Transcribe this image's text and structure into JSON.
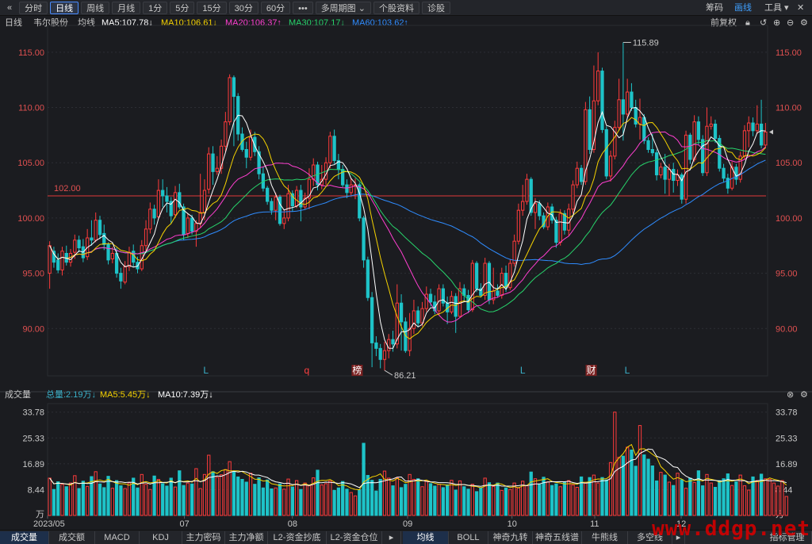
{
  "toolbar": {
    "back": "«",
    "items": [
      "分时",
      "日线",
      "周线",
      "月线",
      "1分",
      "5分",
      "15分",
      "30分",
      "60分",
      "•••",
      "多周期图 ⌄",
      "个股资料",
      "诊股"
    ],
    "active_index": 1,
    "right": [
      "筹码",
      "画线",
      "工具 ▾"
    ],
    "active_color": "#3fa0ff"
  },
  "legend": {
    "period": "日线",
    "stock": "韦尔股份",
    "avg": "均线",
    "ma5": "MA5:107.78↓",
    "ma10": "MA10:106.61↓",
    "ma20": "MA20:106.37↑",
    "ma30": "MA30:107.17↓",
    "ma60": "MA60:103.62↑",
    "adj": "前复权",
    "colors": {
      "ma5": "#ffffff",
      "ma10": "#f5d200",
      "ma20": "#ff3fd0",
      "ma30": "#27d36b",
      "ma60": "#2f8cff"
    }
  },
  "volume_legend": {
    "title": "成交量",
    "total": "总量:2.19万↓",
    "ma5": "MA5:5.45万↓",
    "ma10": "MA10:7.39万↓"
  },
  "chart_data": {
    "type": "candlestick",
    "price_axis": {
      "ticks": [
        "115.00",
        "110.00",
        "105.00",
        "100.00",
        "95.00",
        "90.00"
      ],
      "ylim": [
        86,
        117
      ]
    },
    "volume_axis": {
      "ticks": [
        "33.78",
        "25.33",
        "16.89",
        "8.44",
        "万"
      ],
      "ylim": [
        0,
        35
      ]
    },
    "x_labels": [
      "2023/05",
      "07",
      "08",
      "09",
      "10",
      "11",
      "12"
    ],
    "reference_line": {
      "value": 102.0,
      "label": "102.00"
    },
    "annotations": [
      {
        "text": "115.89"
      },
      {
        "text": "86.21"
      }
    ],
    "markers": [
      {
        "text": "L",
        "color": "#3ab0c8",
        "x": 0.22
      },
      {
        "text": "q",
        "color": "#ff4040",
        "x": 0.36
      },
      {
        "text": "榜",
        "color": "#ffffff",
        "bg": "#7a2020",
        "x": 0.43
      },
      {
        "text": "L",
        "color": "#3ab0c8",
        "x": 0.66
      },
      {
        "text": "财",
        "color": "#ffffff",
        "bg": "#7a2020",
        "x": 0.755
      },
      {
        "text": "L",
        "color": "#3ab0c8",
        "x": 0.805
      }
    ],
    "candles": [
      [
        95.0,
        97.5,
        93.6,
        97.9
      ],
      [
        97.0,
        96.0,
        95.5,
        97.4
      ],
      [
        96.2,
        95.3,
        95.0,
        96.8
      ],
      [
        95.3,
        97.0,
        94.8,
        97.4
      ],
      [
        96.8,
        96.0,
        95.7,
        97.5
      ],
      [
        96.0,
        96.8,
        95.6,
        97.2
      ],
      [
        96.9,
        98.0,
        96.3,
        98.5
      ],
      [
        98.0,
        97.3,
        96.9,
        98.4
      ],
      [
        97.4,
        96.4,
        96.0,
        98.1
      ],
      [
        96.5,
        98.2,
        96.2,
        99.0
      ],
      [
        98.2,
        98.0,
        97.5,
        99.8
      ],
      [
        98.0,
        99.8,
        97.8,
        100.5
      ],
      [
        99.8,
        98.5,
        98.1,
        100.2
      ],
      [
        98.6,
        97.6,
        97.1,
        99.4
      ],
      [
        97.6,
        96.2,
        95.8,
        97.8
      ],
      [
        96.3,
        96.8,
        95.9,
        97.4
      ],
      [
        96.8,
        95.0,
        94.6,
        97.3
      ],
      [
        95.0,
        94.3,
        93.6,
        95.5
      ],
      [
        94.2,
        95.6,
        94.0,
        96.1
      ],
      [
        95.6,
        96.9,
        95.2,
        97.4
      ],
      [
        97.0,
        96.0,
        95.6,
        97.6
      ],
      [
        96.0,
        95.4,
        95.0,
        96.5
      ],
      [
        95.4,
        97.5,
        95.2,
        98.0
      ],
      [
        97.5,
        99.0,
        97.0,
        99.8
      ],
      [
        99.0,
        100.8,
        98.6,
        101.4
      ],
      [
        100.8,
        100.0,
        99.4,
        101.2
      ],
      [
        100.1,
        102.5,
        99.9,
        103.5
      ],
      [
        102.5,
        102.0,
        101.0,
        103.5
      ],
      [
        102.0,
        101.5,
        100.5,
        102.8
      ],
      [
        101.5,
        100.2,
        99.5,
        101.9
      ],
      [
        100.3,
        102.3,
        100.0,
        102.9
      ],
      [
        102.3,
        101.0,
        100.8,
        103.1
      ],
      [
        101.0,
        98.5,
        98.0,
        101.3
      ],
      [
        98.6,
        100.0,
        98.2,
        100.4
      ],
      [
        100.0,
        98.8,
        98.5,
        100.3
      ],
      [
        98.8,
        99.5,
        97.4,
        99.8
      ],
      [
        99.5,
        100.5,
        99.1,
        104.0
      ],
      [
        100.5,
        102.5,
        99.8,
        103.5
      ],
      [
        102.6,
        105.8,
        102.2,
        106.4
      ],
      [
        105.8,
        104.2,
        103.0,
        106.5
      ],
      [
        104.2,
        104.5,
        103.9,
        105.6
      ],
      [
        104.5,
        106.5,
        104.0,
        107.1
      ],
      [
        106.5,
        108.7,
        106.0,
        109.6
      ],
      [
        108.7,
        112.7,
        108.4,
        113.0
      ],
      [
        112.7,
        111.0,
        106.5,
        112.9
      ],
      [
        111.0,
        107.6,
        107.0,
        111.3
      ],
      [
        107.6,
        106.2,
        106.0,
        108.2
      ],
      [
        106.2,
        105.5,
        104.5,
        106.9
      ],
      [
        105.5,
        107.3,
        105.2,
        108.0
      ],
      [
        107.3,
        106.0,
        105.6,
        107.8
      ],
      [
        106.0,
        104.0,
        103.5,
        106.5
      ],
      [
        104.0,
        102.7,
        102.4,
        104.6
      ],
      [
        102.7,
        101.5,
        101.2,
        102.9
      ],
      [
        101.5,
        100.7,
        100.3,
        101.8
      ],
      [
        100.7,
        101.9,
        99.8,
        102.3
      ],
      [
        101.9,
        99.5,
        99.3,
        102.1
      ],
      [
        99.5,
        100.0,
        99.0,
        100.8
      ],
      [
        100.0,
        102.2,
        99.7,
        103.0
      ],
      [
        102.2,
        101.1,
        100.6,
        102.5
      ],
      [
        101.1,
        102.5,
        100.9,
        102.9
      ],
      [
        102.5,
        101.0,
        99.7,
        103.0
      ],
      [
        101.0,
        101.8,
        100.8,
        102.3
      ],
      [
        101.8,
        103.5,
        100.8,
        104.5
      ],
      [
        103.5,
        104.8,
        102.9,
        105.4
      ],
      [
        104.8,
        103.0,
        102.5,
        105.1
      ],
      [
        103.0,
        103.5,
        102.6,
        104.8
      ],
      [
        103.5,
        105.0,
        103.0,
        105.5
      ],
      [
        105.0,
        107.4,
        104.5,
        107.8
      ],
      [
        107.4,
        105.2,
        104.9,
        108.0
      ],
      [
        105.2,
        104.4,
        103.5,
        105.8
      ],
      [
        104.4,
        103.0,
        102.8,
        104.8
      ],
      [
        103.0,
        102.3,
        101.8,
        103.5
      ],
      [
        102.3,
        103.0,
        101.9,
        103.6
      ],
      [
        103.0,
        103.0,
        101.7,
        103.6
      ],
      [
        103.0,
        100.0,
        99.7,
        103.2
      ],
      [
        100.0,
        96.2,
        95.5,
        100.2
      ],
      [
        96.2,
        92.8,
        92.5,
        96.5
      ],
      [
        92.8,
        88.7,
        86.5,
        93.3
      ],
      [
        88.7,
        88.2,
        87.5,
        89.3
      ],
      [
        88.2,
        87.2,
        86.4,
        88.6
      ],
      [
        87.2,
        88.0,
        86.21,
        88.8
      ],
      [
        88.0,
        89.0,
        87.3,
        89.5
      ],
      [
        89.0,
        88.6,
        87.9,
        89.8
      ],
      [
        88.6,
        92.3,
        88.2,
        94.0
      ],
      [
        92.3,
        90.6,
        88.0,
        93.1
      ],
      [
        90.6,
        88.0,
        87.8,
        91.0
      ],
      [
        88.0,
        90.0,
        87.5,
        91.4
      ],
      [
        90.0,
        91.6,
        89.5,
        92.6
      ],
      [
        91.6,
        90.5,
        90.2,
        92.0
      ],
      [
        90.5,
        91.8,
        90.2,
        92.4
      ],
      [
        91.8,
        93.1,
        91.5,
        93.8
      ],
      [
        93.1,
        92.4,
        92.0,
        93.6
      ],
      [
        92.4,
        91.6,
        91.3,
        93.0
      ],
      [
        91.6,
        93.6,
        91.2,
        94.0
      ],
      [
        93.6,
        92.3,
        92.0,
        94.0
      ],
      [
        92.3,
        91.5,
        90.4,
        92.9
      ],
      [
        91.5,
        92.9,
        91.3,
        93.4
      ],
      [
        92.9,
        91.1,
        89.6,
        93.2
      ],
      [
        91.1,
        93.6,
        91.0,
        94.2
      ],
      [
        93.6,
        93.0,
        92.5,
        94.0
      ],
      [
        93.0,
        91.7,
        91.4,
        93.5
      ],
      [
        91.7,
        95.9,
        91.5,
        96.2
      ],
      [
        95.9,
        93.6,
        93.3,
        96.1
      ],
      [
        93.6,
        93.0,
        92.8,
        94.1
      ],
      [
        93.0,
        95.9,
        92.6,
        96.4
      ],
      [
        95.9,
        92.6,
        92.2,
        96.1
      ],
      [
        92.6,
        93.4,
        92.2,
        95.5
      ],
      [
        93.4,
        93.0,
        92.8,
        94.0
      ],
      [
        93.0,
        95.0,
        92.7,
        95.5
      ],
      [
        95.0,
        93.7,
        93.3,
        95.7
      ],
      [
        93.7,
        95.9,
        93.5,
        96.3
      ],
      [
        95.9,
        97.9,
        95.6,
        98.5
      ],
      [
        97.9,
        100.7,
        97.6,
        101.3
      ],
      [
        100.7,
        101.5,
        100.2,
        103.0
      ],
      [
        101.5,
        103.5,
        101.2,
        104.0
      ],
      [
        103.5,
        100.5,
        100.2,
        103.7
      ],
      [
        100.5,
        101.3,
        99.0,
        101.8
      ],
      [
        101.3,
        100.2,
        99.8,
        101.6
      ],
      [
        100.2,
        99.2,
        99.0,
        100.5
      ],
      [
        99.2,
        101.0,
        98.9,
        101.4
      ],
      [
        101.0,
        99.8,
        99.5,
        101.3
      ],
      [
        99.8,
        97.8,
        97.3,
        100.1
      ],
      [
        97.8,
        100.4,
        97.5,
        100.8
      ],
      [
        100.4,
        98.9,
        98.5,
        100.7
      ],
      [
        98.9,
        100.8,
        98.4,
        101.3
      ],
      [
        100.8,
        103.0,
        100.4,
        103.4
      ],
      [
        103.0,
        104.5,
        102.7,
        105.1
      ],
      [
        104.5,
        103.3,
        103.0,
        104.8
      ],
      [
        103.3,
        109.8,
        103.0,
        110.5
      ],
      [
        109.8,
        106.2,
        105.8,
        111.0
      ],
      [
        106.2,
        110.6,
        105.9,
        113.8
      ],
      [
        110.6,
        113.3,
        110.2,
        115.0
      ],
      [
        113.3,
        108.0,
        107.7,
        113.6
      ],
      [
        108.0,
        103.8,
        103.5,
        108.3
      ],
      [
        103.8,
        105.6,
        103.3,
        106.1
      ],
      [
        105.6,
        108.2,
        105.3,
        108.8
      ],
      [
        108.2,
        110.7,
        107.9,
        112.6
      ],
      [
        110.7,
        109.4,
        107.0,
        115.89
      ],
      [
        109.4,
        111.4,
        109.1,
        112.6
      ],
      [
        111.4,
        110.0,
        109.7,
        112.2
      ],
      [
        110.0,
        108.5,
        108.2,
        110.7
      ],
      [
        108.5,
        109.1,
        107.1,
        110.8
      ],
      [
        109.1,
        107.0,
        106.7,
        109.4
      ],
      [
        107.0,
        106.2,
        105.9,
        107.3
      ],
      [
        106.2,
        105.9,
        105.6,
        107.6
      ],
      [
        105.9,
        103.9,
        103.4,
        106.2
      ],
      [
        103.9,
        104.6,
        103.6,
        105.0
      ],
      [
        104.6,
        103.5,
        102.2,
        105.8
      ],
      [
        103.5,
        104.4,
        102.0,
        104.9
      ],
      [
        104.4,
        103.4,
        102.3,
        105.0
      ],
      [
        103.4,
        103.9,
        102.9,
        104.4
      ],
      [
        103.9,
        101.7,
        101.3,
        104.1
      ],
      [
        101.7,
        107.5,
        101.3,
        107.9
      ],
      [
        107.5,
        105.3,
        104.9,
        107.7
      ],
      [
        105.3,
        108.7,
        105.1,
        109.3
      ],
      [
        108.7,
        107.1,
        106.6,
        109.2
      ],
      [
        107.1,
        104.1,
        103.8,
        107.5
      ],
      [
        104.1,
        108.3,
        103.8,
        110.0
      ],
      [
        108.3,
        108.5,
        108.0,
        109.2
      ],
      [
        108.5,
        107.2,
        106.8,
        108.9
      ],
      [
        107.2,
        104.5,
        104.2,
        107.5
      ],
      [
        104.5,
        103.6,
        103.2,
        104.9
      ],
      [
        103.6,
        102.7,
        102.2,
        104.0
      ],
      [
        102.7,
        104.6,
        102.5,
        105.1
      ],
      [
        104.6,
        103.5,
        103.0,
        104.9
      ],
      [
        103.5,
        105.6,
        103.2,
        106.0
      ],
      [
        105.6,
        107.9,
        105.3,
        108.4
      ],
      [
        107.9,
        108.6,
        106.4,
        109.2
      ],
      [
        108.6,
        107.9,
        107.4,
        109.1
      ],
      [
        107.9,
        108.5,
        107.6,
        110.2
      ],
      [
        108.5,
        106.6,
        106.3,
        110.7
      ],
      [
        106.6,
        107.78,
        106.3,
        108.6
      ]
    ],
    "volumes": [
      12.2,
      8.5,
      11.0,
      10.2,
      9.4,
      10.6,
      13.0,
      8.8,
      11.2,
      9.5,
      12.7,
      14.3,
      10.3,
      9.1,
      12.8,
      8.9,
      11.4,
      9.7,
      8.8,
      10.6,
      12.2,
      9.0,
      13.4,
      10.2,
      8.5,
      12.9,
      11.8,
      10.4,
      9.6,
      12.2,
      9.3,
      14.6,
      9.8,
      10.6,
      10.3,
      15.3,
      8.8,
      13.4,
      19.7,
      14.3,
      12.5,
      13.3,
      15.0,
      17.6,
      14.5,
      12.6,
      11.8,
      10.9,
      13.8,
      10.2,
      12.3,
      9.0,
      11.6,
      8.7,
      9.0,
      10.3,
      8.6,
      11.9,
      9.3,
      11.4,
      8.5,
      10.6,
      9.7,
      12.3,
      14.8,
      10.0,
      10.4,
      11.3,
      8.2,
      9.0,
      11.1,
      8.6,
      7.5,
      6.4,
      8.4,
      23.6,
      13.1,
      11.5,
      8.0,
      11.8,
      14.5,
      12.2,
      9.7,
      12.3,
      9.1,
      10.2,
      13.4,
      11.8,
      12.0,
      9.4,
      11.3,
      10.4,
      9.6,
      10.2,
      9.1,
      10.0,
      11.5,
      8.3,
      11.3,
      9.4,
      8.6,
      10.2,
      7.8,
      9.1,
      12.2,
      10.7,
      9.5,
      10.6,
      8.2,
      9.0,
      8.5,
      10.6,
      9.0,
      11.2,
      9.8,
      14.2,
      12.0,
      10.3,
      12.5,
      11.0,
      9.8,
      10.3,
      9.4,
      10.9,
      11.4,
      10.0,
      9.2,
      12.6,
      10.8,
      12.4,
      13.2,
      10.6,
      12.4,
      11.6,
      17.3,
      33.78,
      19.0,
      19.4,
      22.3,
      21.4,
      16.1,
      29.4,
      19.8,
      18.4,
      16.2,
      11.3,
      14.1,
      13.2,
      10.9,
      9.8,
      13.8,
      11.7,
      8.9,
      12.2,
      10.8,
      14.6,
      9.7,
      13.4,
      10.6,
      9.2,
      11.4,
      12.0,
      13.6,
      9.8,
      11.0,
      13.2,
      9.7,
      8.3,
      12.6,
      11.4,
      13.5,
      12.0,
      11.8,
      10.6,
      9.6,
      11.4,
      6.2
    ]
  },
  "volume_unit": "万",
  "bottom_tabs": [
    "成交量",
    "成交额",
    "MACD",
    "KDJ",
    "主力密码",
    "主力净额",
    "L2-资金抄底",
    "L2-资金仓位",
    "均线",
    "BOLL",
    "神奇九转",
    "神奇五线谱",
    "牛熊线",
    "多空线",
    "指标管理"
  ],
  "bottom_active": [
    0,
    8
  ],
  "watermark": "www.ddgp.net"
}
